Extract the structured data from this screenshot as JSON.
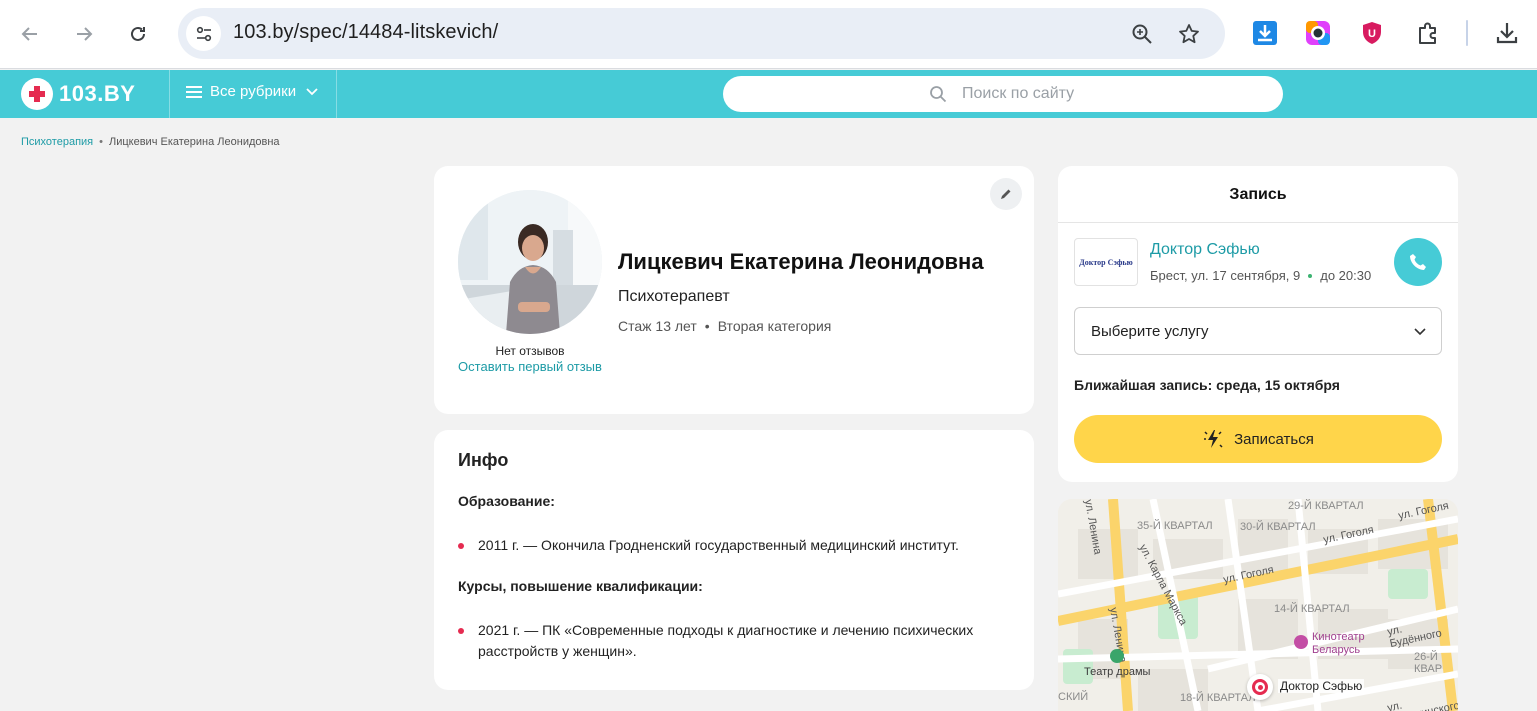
{
  "browser": {
    "url": "103.by/spec/14484-litskevich/",
    "icons": [
      "back-arrow-icon",
      "forward-arrow-icon",
      "reload-icon",
      "site-settings-icon",
      "zoom-icon",
      "star-icon",
      "download-extension-icon",
      "camera-extension-icon",
      "shield-extension-icon",
      "puzzle-icon",
      "download-icon"
    ]
  },
  "site": {
    "logo_text": "103.BY",
    "rubrics_label": "Все рубрики",
    "search_placeholder": "Поиск по сайту",
    "accent_color": "#46cbd6"
  },
  "breadcrumb": {
    "category": "Психотерапия",
    "current": "Лицкевич Екатерина Леонидовна"
  },
  "profile": {
    "name": "Лицкевич Екатерина Леонидовна",
    "specialty": "Психотерапевт",
    "experience": "Стаж 13 лет",
    "category": "Вторая категория",
    "reviews_status": "Нет отзывов",
    "leave_review_link": "Оставить первый отзыв"
  },
  "info": {
    "title": "Инфо",
    "education_heading": "Образование:",
    "education_items": [
      "2011 г. — Окончила Гродненский государственный медицинский институт."
    ],
    "courses_heading": "Курсы, повышение квалификации:",
    "courses_items": [
      "2021 г. — ПК «Современные подходы к диагностике и лечению психических расстройств у женщин»."
    ]
  },
  "booking": {
    "title": "Запись",
    "clinic_name": "Доктор Сэфью",
    "clinic_logo_text": "Доктор Сэфью",
    "address": "Брест, ул. 17 сентября, 9",
    "hours": "до 20:30",
    "service_placeholder": "Выберите услугу",
    "nearest": "Ближайшая запись: среда, 15 октября",
    "book_button": "Записаться",
    "button_color": "#ffd54a"
  },
  "map": {
    "labels": [
      "29-Й КВАРТАЛ",
      "35-Й КВАРТАЛ",
      "30-Й КВАРТАЛ",
      "ул. Гоголя",
      "ул. Гоголя",
      "ул. Гоголя",
      "ул. Карла Маркса",
      "ул. Ленина",
      "ул. Ленина",
      "14-Й КВАРТАЛ",
      "ул. Будённого",
      "Кинотеатр",
      "Беларусь",
      "26-Й КВАР",
      "Театр драмы",
      "18-Й КВАРТАЛ",
      "ул. Дзержинского",
      "СКИЙ"
    ],
    "marker_label": "Доктор Сэфью"
  }
}
